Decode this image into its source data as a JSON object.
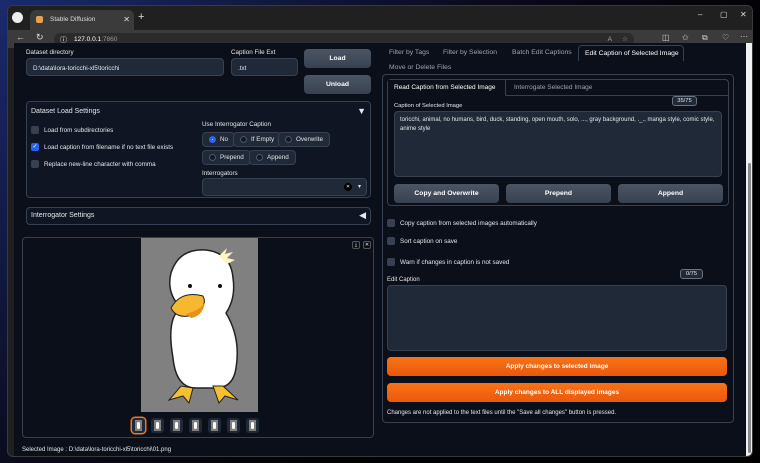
{
  "browser": {
    "tab_title": "Stable Diffusion",
    "url_host": "127.0.0.1",
    "url_port": ":7860"
  },
  "left": {
    "dataset_dir_label": "Dataset directory",
    "dataset_dir_value": "D:\\data\\lora-toricchi-xl5\\toricchi",
    "ext_label": "Caption File Ext",
    "ext_value": ".txt",
    "load": "Load",
    "unload": "Unload",
    "load_settings": {
      "title": "Dataset Load Settings",
      "checkboxes": [
        {
          "label": "Load from subdirectories",
          "checked": false
        },
        {
          "label": "Load caption from filename if no text file exists",
          "checked": true
        },
        {
          "label": "Replace new-line character with comma",
          "checked": false
        }
      ],
      "interrogator_caption_label": "Use Interrogator Caption",
      "radios": [
        {
          "label": "No",
          "selected": true
        },
        {
          "label": "If Empty",
          "selected": false
        },
        {
          "label": "Overwrite",
          "selected": false
        },
        {
          "label": "Prepend",
          "selected": false
        },
        {
          "label": "Append",
          "selected": false
        }
      ],
      "interrogators_label": "Interrogators"
    },
    "interrogator_settings": "Interrogator Settings",
    "thumbnail_count": 7,
    "selected_image": "Selected Image : D:\\data\\lora-toricchi-xl5\\toricchi\\01.png"
  },
  "right": {
    "tabs": [
      "Filter by Tags",
      "Filter by Selection",
      "Batch Edit Captions",
      "Edit Caption of Selected Image",
      "Move or Delete Files"
    ],
    "subtabs": [
      "Read Caption from Selected Image",
      "Interrogate Selected Image"
    ],
    "caption_label": "Caption of Selected Image",
    "caption_counter": "35/75",
    "caption_text": "toricchi, animal, no humans, bird, duck, standing, open mouth, solo, ..., gray background, ._., manga style, comic style, anime style",
    "copy_overwrite": "Copy and Overwrite",
    "prepend": "Prepend",
    "append": "Append",
    "options": [
      "Copy caption from selected images automatically",
      "Sort caption on save",
      "Warn if changes in caption is not saved"
    ],
    "edit_label": "Edit Caption",
    "edit_counter": "0/75",
    "apply_selected": "Apply changes to selected image",
    "apply_all": "Apply changes to ALL displayed images",
    "note": "Changes are not applied to the text files until the \"Save all changes\" button is pressed."
  }
}
